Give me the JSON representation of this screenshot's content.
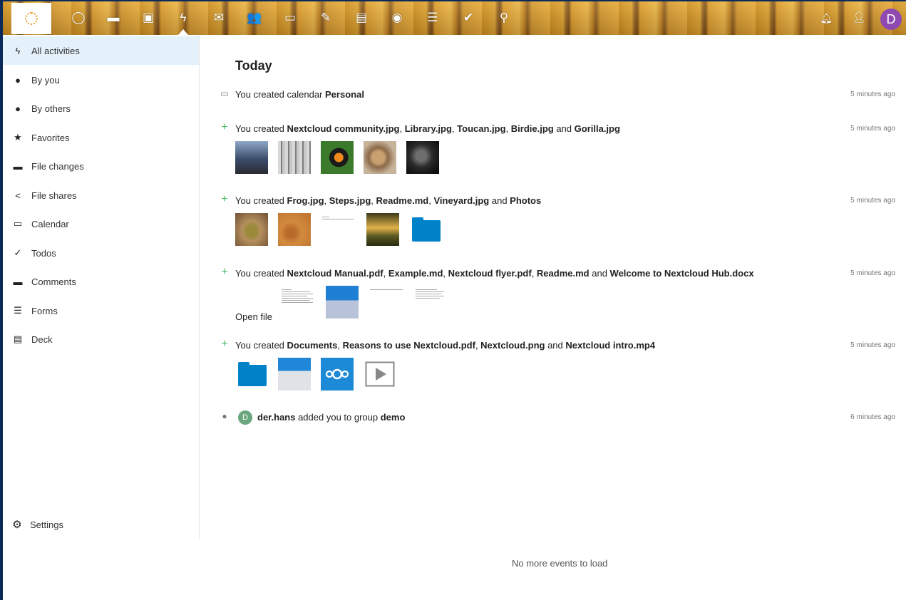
{
  "header": {
    "nav_icons": [
      "dashboard-icon",
      "files-icon",
      "photos-icon",
      "activity-icon",
      "mail-icon",
      "contacts-icon",
      "calendar-icon",
      "notes-icon",
      "deck-icon",
      "podcast-icon",
      "forms-icon",
      "tasks-icon",
      "search-icon"
    ],
    "notifications_icon": "bell-icon",
    "contacts_menu_icon": "person-icon",
    "avatar_letter": "D",
    "avatar_color": "#8e4ab0"
  },
  "sidebar": {
    "items": [
      {
        "label": "All activities",
        "icon": "lightning-icon"
      },
      {
        "label": "By you",
        "icon": "person-icon"
      },
      {
        "label": "By others",
        "icon": "people-icon"
      },
      {
        "label": "Favorites",
        "icon": "star-icon"
      },
      {
        "label": "File changes",
        "icon": "folder-icon"
      },
      {
        "label": "File shares",
        "icon": "share-icon"
      },
      {
        "label": "Calendar",
        "icon": "calendar-icon"
      },
      {
        "label": "Todos",
        "icon": "check-icon"
      },
      {
        "label": "Comments",
        "icon": "comment-icon"
      },
      {
        "label": "Forms",
        "icon": "list-icon"
      },
      {
        "label": "Deck",
        "icon": "deck-icon"
      }
    ],
    "settings_label": "Settings"
  },
  "main": {
    "day_title": "Today",
    "activities": [
      {
        "parts": [
          "You created calendar ",
          "Personal"
        ],
        "time": "5 minutes ago"
      },
      {
        "parts": [
          "You created ",
          "Nextcloud community.jpg",
          ", ",
          "Library.jpg",
          ", ",
          "Toucan.jpg",
          ", ",
          "Birdie.jpg",
          " and ",
          "Gorilla.jpg"
        ],
        "time": "5 minutes ago"
      },
      {
        "parts": [
          "You created ",
          "Frog.jpg",
          ", ",
          "Steps.jpg",
          ", ",
          "Readme.md",
          ", ",
          "Vineyard.jpg",
          " and ",
          "Photos"
        ],
        "time": "5 minutes ago"
      },
      {
        "parts": [
          "You created ",
          "Nextcloud Manual.pdf",
          ", ",
          "Example.md",
          ", ",
          "Nextcloud flyer.pdf",
          ", ",
          "Readme.md",
          " and ",
          "Welcome to Nextcloud Hub.docx"
        ],
        "time": "5 minutes ago",
        "open_file": "Open file"
      },
      {
        "parts": [
          "You created ",
          "Documents",
          ", ",
          "Reasons to use Nextcloud.pdf",
          ", ",
          "Nextcloud.png",
          " and ",
          "Nextcloud intro.mp4"
        ],
        "time": "5 minutes ago"
      },
      {
        "parts": [
          "der.hans",
          " added you to group ",
          "demo"
        ],
        "time": "6 minutes ago",
        "avatar_letter": "D"
      }
    ],
    "no_more": "No more events to load"
  }
}
